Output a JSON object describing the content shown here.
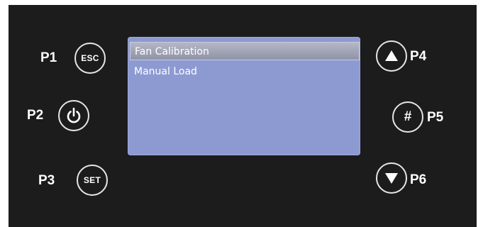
{
  "panel": {
    "labels": {
      "p1": "P1",
      "p2": "P2",
      "p3": "P3",
      "p4": "P4",
      "p5": "P5",
      "p6": "P6"
    },
    "buttons": {
      "esc": "ESC",
      "power": "power-icon",
      "set": "SET",
      "up": "triangle-up-icon",
      "hash": "#",
      "down": "triangle-down-icon"
    }
  },
  "display": {
    "menu_items": [
      "Fan Calibration",
      "Manual Load"
    ],
    "selected_item": "Fan Calibration"
  },
  "colors": {
    "panel": "#1c1c1c",
    "lcd_background": "#8d9ad2",
    "lcd_highlight": "#a6aabd",
    "text": "#ffffff"
  }
}
